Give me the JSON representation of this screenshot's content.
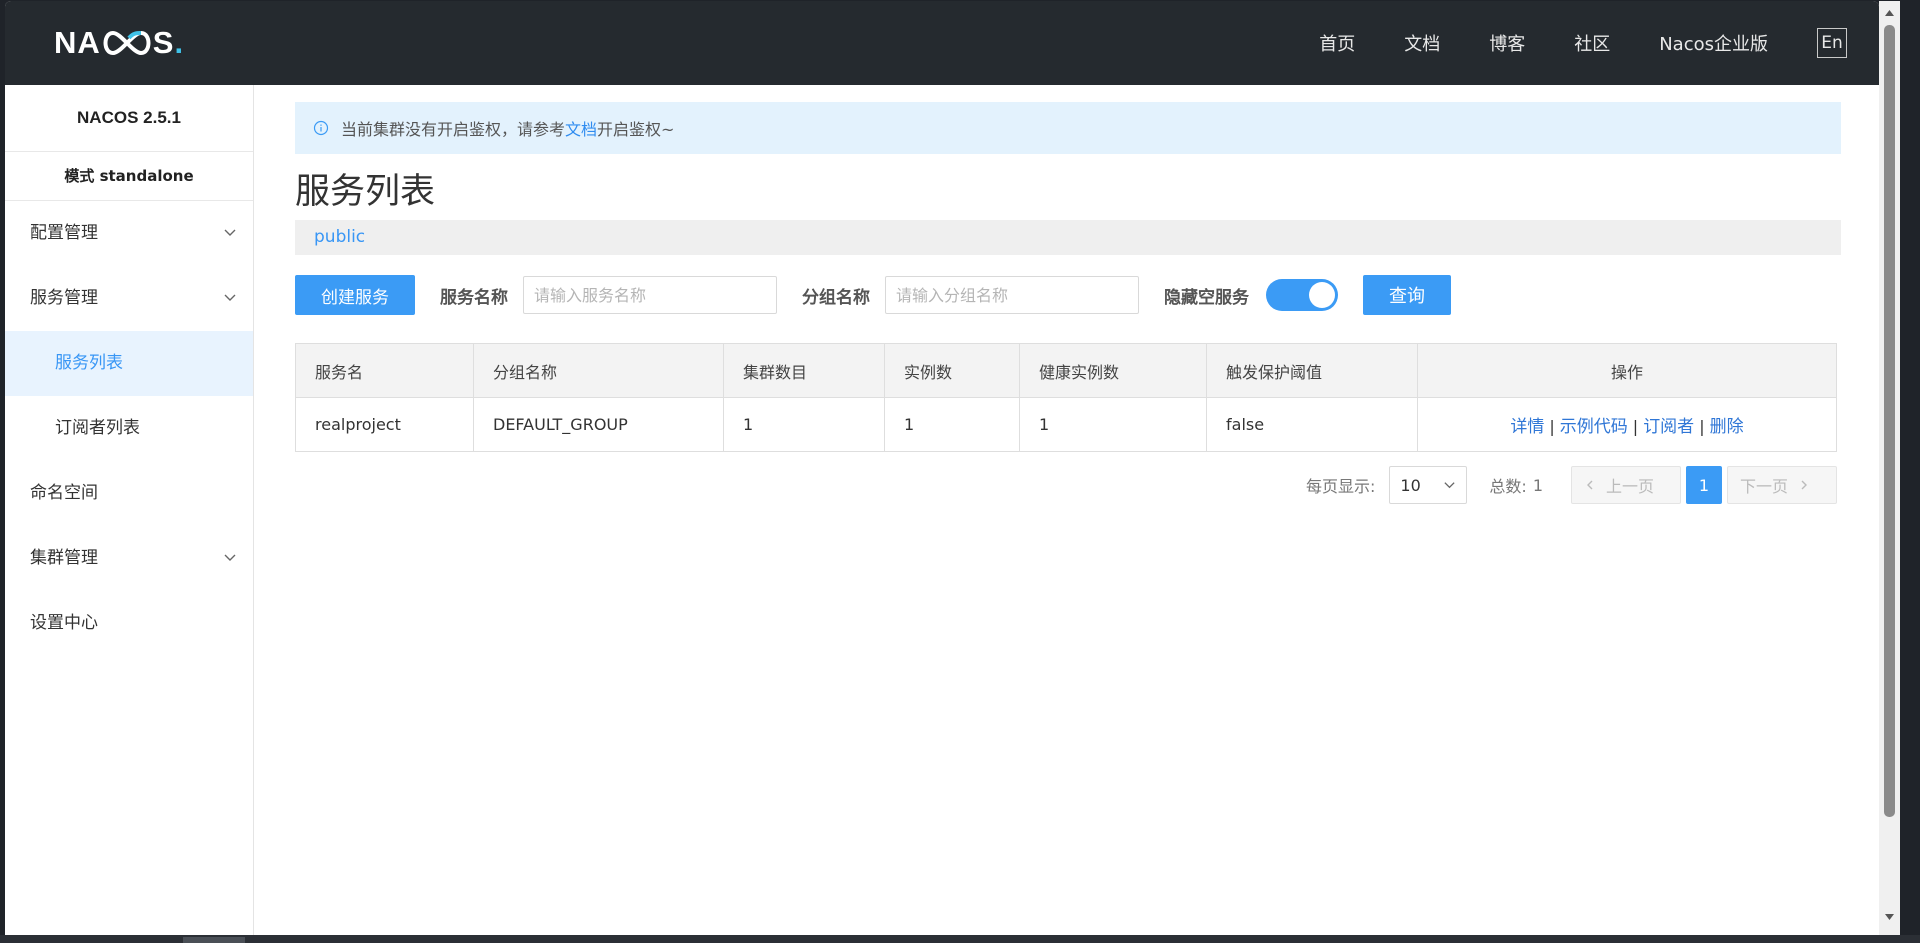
{
  "app": {
    "logo_text": "NACOS.",
    "brand_color": "#3fc2e8",
    "accent_color": "#3b9bf5"
  },
  "topnav": {
    "items": [
      "首页",
      "文档",
      "博客",
      "社区",
      "Nacos企业版"
    ],
    "lang_button": "En"
  },
  "sidebar": {
    "version": "NACOS 2.5.1",
    "mode": "模式 standalone",
    "items": [
      {
        "label": "配置管理",
        "expandable": true
      },
      {
        "label": "服务管理",
        "expandable": true
      },
      {
        "label": "服务列表",
        "active": true
      },
      {
        "label": "订阅者列表"
      },
      {
        "label": "命名空间"
      },
      {
        "label": "集群管理",
        "expandable": true
      },
      {
        "label": "设置中心"
      }
    ]
  },
  "notice": {
    "icon": "info-icon",
    "prefix": "当前集群没有开启鉴权，请参考",
    "link": "文档",
    "suffix": "开启鉴权~"
  },
  "main": {
    "title": "服务列表",
    "namespace": "public"
  },
  "toolbar": {
    "create_label": "创建服务",
    "service_name_label": "服务名称",
    "service_name_placeholder": "请输入服务名称",
    "group_name_label": "分组名称",
    "group_name_placeholder": "请输入分组名称",
    "hide_empty_label": "隐藏空服务",
    "hide_empty_on": true,
    "query_label": "查询"
  },
  "table": {
    "headers": [
      "服务名",
      "分组名称",
      "集群数目",
      "实例数",
      "健康实例数",
      "触发保护阈值",
      "操作"
    ],
    "rows": [
      {
        "service": "realproject",
        "group": "DEFAULT_GROUP",
        "clusters": "1",
        "instances": "1",
        "healthy": "1",
        "threshold": "false",
        "actions": [
          "详情",
          "示例代码",
          "订阅者",
          "删除"
        ]
      }
    ]
  },
  "pagination": {
    "page_size_label": "每页显示:",
    "page_size": "10",
    "total_label": "总数:",
    "total": "1",
    "prev": "上一页",
    "next": "下一页",
    "current": "1"
  }
}
